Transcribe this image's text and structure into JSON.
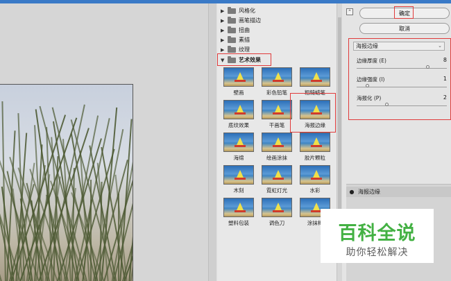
{
  "tree": {
    "categories": [
      {
        "label": "风格化",
        "open": false
      },
      {
        "label": "画笔描边",
        "open": false
      },
      {
        "label": "扭曲",
        "open": false
      },
      {
        "label": "素描",
        "open": false
      },
      {
        "label": "纹理",
        "open": false
      },
      {
        "label": "艺术效果",
        "open": true
      }
    ],
    "filters": [
      {
        "label": "壁画"
      },
      {
        "label": "彩色铅笔"
      },
      {
        "label": "粗糙蜡笔"
      },
      {
        "label": "底纹效果"
      },
      {
        "label": "干画笔"
      },
      {
        "label": "海报边缘"
      },
      {
        "label": "海绵"
      },
      {
        "label": "绘画涂抹"
      },
      {
        "label": "胶片颗粒"
      },
      {
        "label": "木刻"
      },
      {
        "label": "霓虹灯光"
      },
      {
        "label": "水彩"
      },
      {
        "label": "塑料包装"
      },
      {
        "label": "调色刀"
      },
      {
        "label": "涂抹棒"
      }
    ],
    "selected_filter": "海报边缘"
  },
  "settings": {
    "ok_label": "确定",
    "cancel_label": "取消",
    "filter_select_value": "海报边缘",
    "params": [
      {
        "label": "边缘厚度 (E)",
        "value": "8",
        "fraction": 0.8
      },
      {
        "label": "边缘强度 (I)",
        "value": "1",
        "fraction": 0.1
      },
      {
        "label": "海报化 (P)",
        "value": "2",
        "fraction": 0.33
      }
    ]
  },
  "layers": {
    "row_label": "海报边缘"
  },
  "watermark": {
    "title": "百科全说",
    "subtitle": "助你轻松解决"
  },
  "icons": {
    "collapse": "collapse-icon",
    "eye": "eye-icon",
    "folder": "folder-icon"
  },
  "colors": {
    "highlight": "#e03a3a",
    "watermark_green": "#43b143"
  }
}
